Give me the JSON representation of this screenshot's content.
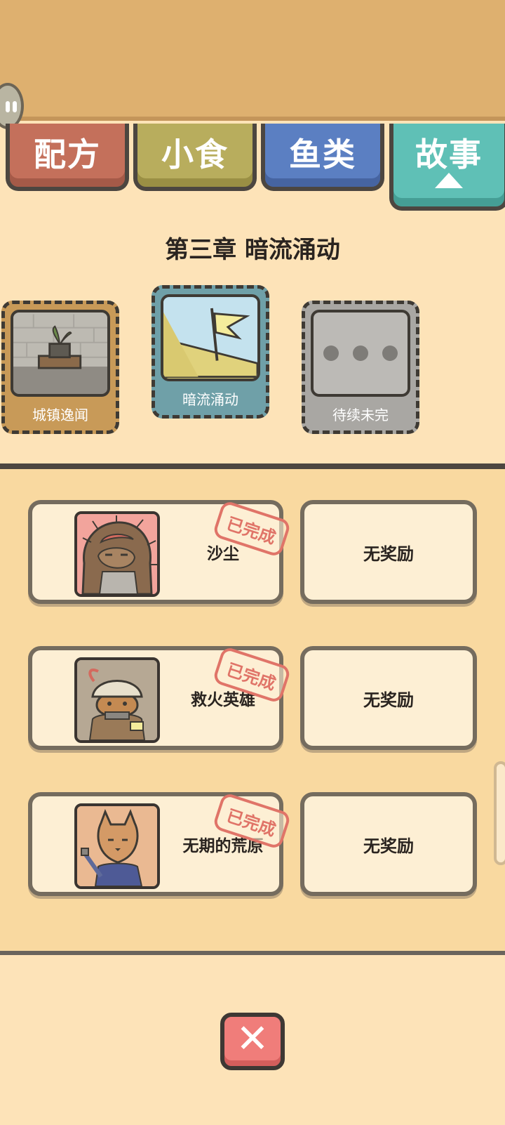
{
  "tabs": [
    {
      "label": "配方"
    },
    {
      "label": "小食"
    },
    {
      "label": "鱼类"
    },
    {
      "label": "故事"
    }
  ],
  "chapter_title": "第三章 暗流涌动",
  "chapters": [
    {
      "label": "城镇逸闻"
    },
    {
      "label": "暗流涌动"
    },
    {
      "label": "待续未完"
    }
  ],
  "stories": [
    {
      "name": "沙尘",
      "status": "已完成",
      "reward": "无奖励"
    },
    {
      "name": "救火英雄",
      "status": "已完成",
      "reward": "无奖励"
    },
    {
      "name": "无期的荒原",
      "status": "已完成",
      "reward": "无奖励"
    }
  ],
  "close_symbol": "✕",
  "colors": {
    "tab_recipe": "#c4705b",
    "tab_snack": "#b8ad5d",
    "tab_fish": "#5b7fc2",
    "tab_story": "#5fc0b6",
    "stamp": "#e07468",
    "close_button": "#f07d7a"
  }
}
